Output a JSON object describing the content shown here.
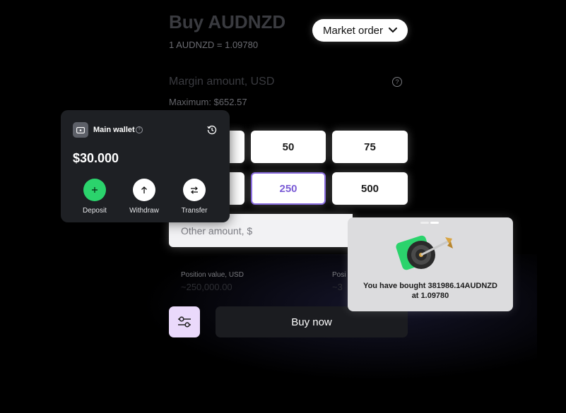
{
  "trade": {
    "title": "Buy AUDNZD",
    "rate": "1 AUDNZD = 1.09780",
    "order_type": "Market order",
    "margin_label": "Margin amount, USD",
    "maximum": "Maximum: $652.57",
    "amounts": [
      "50",
      "75",
      "250",
      "500"
    ],
    "selected_amount": "250",
    "other_placeholder": "Other amount, $",
    "position_value_label": "Position value, USD",
    "position_value": "~250,000.00",
    "position2_label": "Posi",
    "position2_value": "~3",
    "buy_label": "Buy now"
  },
  "wallet": {
    "title": "Main wallet",
    "balance": "$30.000",
    "actions": [
      "Deposit",
      "Withdraw",
      "Transfer"
    ]
  },
  "toast": {
    "line1": "You have bought 381986.14AUDNZD",
    "line2": "at 1.09780"
  },
  "colors": {
    "accent_purple": "#8a6de0",
    "deposit_green": "#2bd36c",
    "settings_bg": "#ead9fb"
  },
  "icons": [
    "chevron-down-icon",
    "help-icon",
    "wallet-icon",
    "history-icon",
    "plus-icon",
    "arrow-up-icon",
    "transfer-icon",
    "sliders-icon",
    "target-icon"
  ]
}
